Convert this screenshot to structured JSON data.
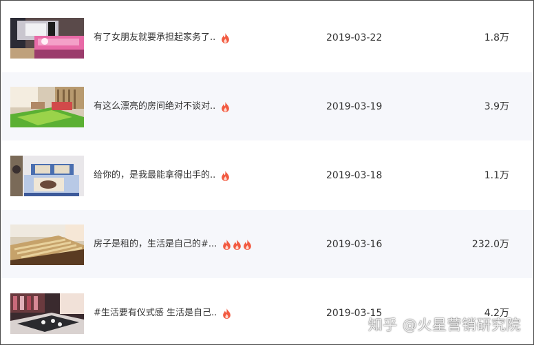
{
  "rows": [
    {
      "title": "有了女朋友就要承担起家务了..",
      "date": "2019-03-22",
      "count": "1.8万",
      "fire_count": 1,
      "thumb": "pink-bedroom-thumbnail"
    },
    {
      "title": "有这么漂亮的房间绝对不谈对..",
      "date": "2019-03-19",
      "count": "3.9万",
      "fire_count": 1,
      "thumb": "sunlit-room-thumbnail"
    },
    {
      "title": "给你的，是我最能拿得出手的..",
      "date": "2019-03-18",
      "count": "1.1万",
      "fire_count": 1,
      "thumb": "bed-with-pillows-thumbnail"
    },
    {
      "title": "房子是租的，生活是自己的#...",
      "date": "2019-03-16",
      "count": "232.0万",
      "fire_count": 3,
      "thumb": "wooden-bed-frame-thumbnail"
    },
    {
      "title": "#生活要有仪式感 生活是自己..",
      "date": "2019-03-15",
      "count": "4.2万",
      "fire_count": 1,
      "thumb": "dark-bedroom-thumbnail"
    }
  ],
  "watermark": "知乎 @火星营销研究院",
  "colors": {
    "alt_row": "#f6f7fb",
    "fire": "#f25a41",
    "text": "#333333"
  }
}
